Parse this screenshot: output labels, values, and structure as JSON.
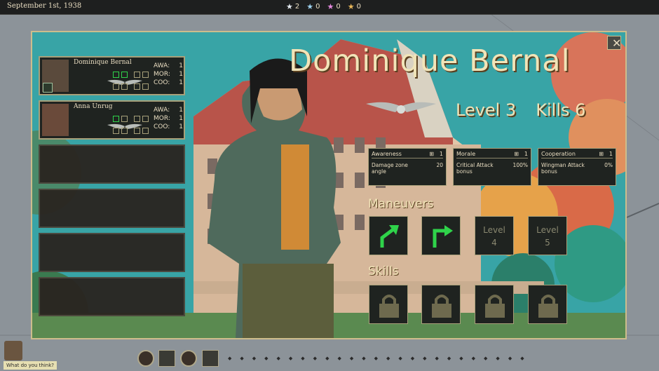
{
  "topbar": {
    "date": "September 1st, 1938",
    "stars": [
      {
        "icon": "white-star-icon",
        "color": "#e6ecf2",
        "count": "2"
      },
      {
        "icon": "blue-star-icon",
        "color": "#9fd3f0",
        "count": "0"
      },
      {
        "icon": "pink-star-icon",
        "color": "#e78be0",
        "count": "0"
      },
      {
        "icon": "gold-star-icon",
        "color": "#e8b75a",
        "count": "0"
      }
    ]
  },
  "pilot": {
    "name": "Dominique Bernal",
    "level": "Level 3",
    "kills": "Kills 6"
  },
  "roster": [
    {
      "name": "Dominique Bernal",
      "awa_label": "AWA:",
      "awa": "1",
      "mor_label": "MOR:",
      "mor": "1",
      "coo_label": "COO:",
      "coo": "1"
    },
    {
      "name": "Anna Unrug",
      "awa_label": "AWA:",
      "awa": "1",
      "mor_label": "MOR:",
      "mor": "1",
      "coo_label": "COO:",
      "coo": "1"
    }
  ],
  "stats": [
    {
      "title": "Awareness",
      "value": "1",
      "desc": "Damage zone angle",
      "bonus": "20"
    },
    {
      "title": "Morale",
      "value": "1",
      "desc": "Critical Attack bonus",
      "bonus": "100%"
    },
    {
      "title": "Cooperation",
      "value": "1",
      "desc": "Wingman Attack bonus",
      "bonus": "0%"
    }
  ],
  "sections": {
    "maneuvers": "Maneuvers",
    "skills": "Skills"
  },
  "maneuvers": [
    {
      "icon": "turn-up-right-arrow-icon",
      "state": "unlocked"
    },
    {
      "icon": "turn-right-arrow-icon",
      "state": "unlocked"
    },
    {
      "label_line1": "Level",
      "label_line2": "4",
      "state": "locked"
    },
    {
      "label_line1": "Level",
      "label_line2": "5",
      "state": "locked"
    }
  ],
  "skills": [
    {
      "icon": "padlock-icon"
    },
    {
      "icon": "padlock-icon"
    },
    {
      "icon": "padlock-icon"
    },
    {
      "icon": "padlock-icon"
    }
  ],
  "advisor": {
    "prompt": "What do you think?"
  },
  "colors": {
    "accent_green": "#2fd34a",
    "panel_border": "#cdbd8c",
    "title_text": "#f1e4b8"
  }
}
